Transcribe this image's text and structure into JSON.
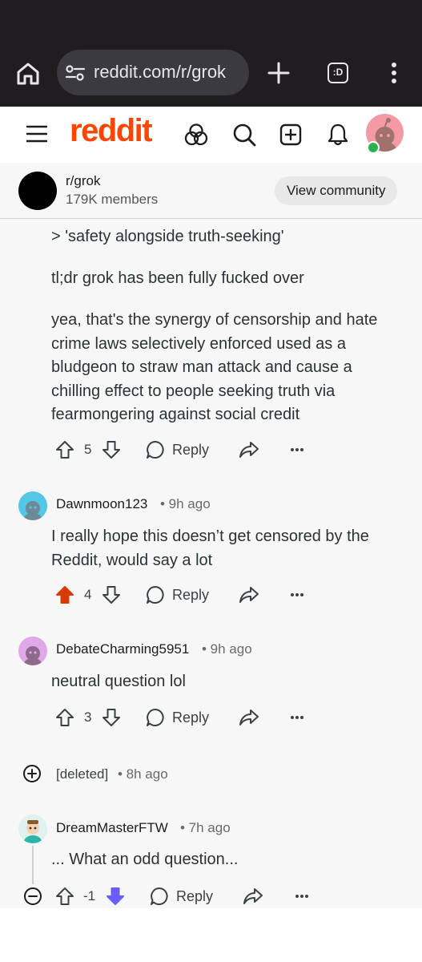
{
  "browser": {
    "url": "reddit.com/r/grok",
    "tabs_label": ":D"
  },
  "header": {
    "logo_text": "reddit",
    "brand_color": "#ff4500"
  },
  "community": {
    "name": "r/grok",
    "members": "179K members",
    "view_label": "View community"
  },
  "parent_comment": {
    "paragraphs": [
      "> 'safety alongside truth-seeking'",
      "tl;dr grok has been fully fucked over",
      "yea, that's the synergy of censorship and hate crime laws selectively enforced used as a bludgeon to straw man attack and cause a chilling effect to people seeking truth via fearmongering against social credit"
    ],
    "score": "5",
    "reply_label": "Reply"
  },
  "comments": [
    {
      "username": "Dawnmoon123",
      "time": "• 9h ago",
      "text": "I really hope this doesn’t get censored by the Reddit, would say a lot",
      "score": "4",
      "upvoted": true,
      "reply_label": "Reply"
    },
    {
      "username": "DebateCharming5951",
      "time": "• 9h ago",
      "text": "neutral question lol",
      "score": "3",
      "reply_label": "Reply"
    },
    {
      "username": "[deleted]",
      "time": "• 8h ago",
      "collapsed": true
    },
    {
      "username": "DreamMasterFTW",
      "time": "• 7h ago",
      "text": "... What an odd question...",
      "score": "-1",
      "downvoted": true,
      "reply_label": "Reply"
    }
  ],
  "colors": {
    "upvote_active": "#d93a00",
    "downvote_active": "#6a5cff",
    "more_icon": "#3a4246"
  }
}
